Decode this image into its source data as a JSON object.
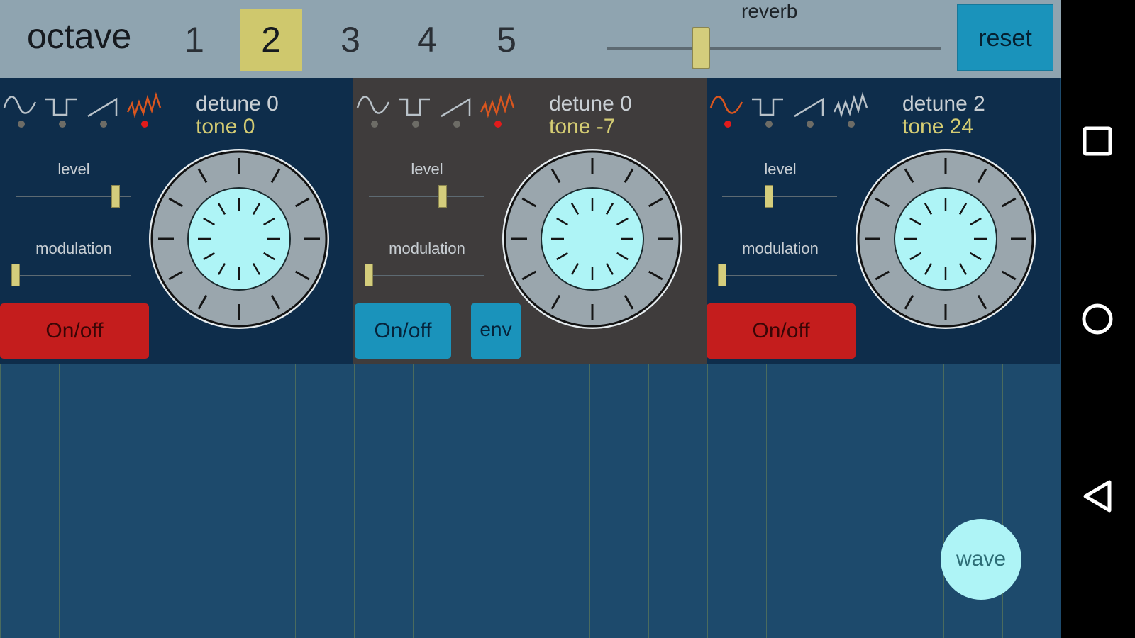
{
  "topbar": {
    "octave_label": "octave",
    "octaves": [
      "1",
      "2",
      "3",
      "4",
      "5"
    ],
    "selected_octave": "2",
    "reverb_label": "reverb",
    "reverb_value_fraction": 0.28,
    "reset_label": "reset"
  },
  "oscillators": [
    {
      "detune": "detune 0",
      "tone": "tone 0",
      "selected_wave": 3,
      "level_label": "level",
      "level_fraction": 0.9,
      "modulation_label": "modulation",
      "modulation_fraction": 0.0,
      "onoff_label": "On/off",
      "onoff_state": "off",
      "env_label": null
    },
    {
      "detune": "detune 0",
      "tone": "tone -7",
      "selected_wave": 3,
      "level_label": "level",
      "level_fraction": 0.65,
      "modulation_label": "modulation",
      "modulation_fraction": 0.0,
      "onoff_label": "On/off",
      "onoff_state": "on",
      "env_label": "env"
    },
    {
      "detune": "detune 2",
      "tone": "tone 24",
      "selected_wave": 0,
      "level_label": "level",
      "level_fraction": 0.4,
      "modulation_label": "modulation",
      "modulation_fraction": 0.0,
      "onoff_label": "On/off",
      "onoff_state": "off",
      "env_label": null
    }
  ],
  "wave_names": [
    "sine-wave-icon",
    "square-wave-icon",
    "sawtooth-wave-icon",
    "noise-wave-icon"
  ],
  "keyboard": {
    "key_count": 18
  },
  "wave_button_label": "wave",
  "navbar": {
    "items": [
      "recent-apps-icon",
      "home-icon",
      "back-icon"
    ]
  },
  "colors": {
    "selected_wave_dot": "#e21b1b",
    "off_button": "#c41d1d",
    "on_button": "#1a93bb",
    "accent_yellow": "#d4cc73",
    "knob_inner": "#aef4f6"
  }
}
